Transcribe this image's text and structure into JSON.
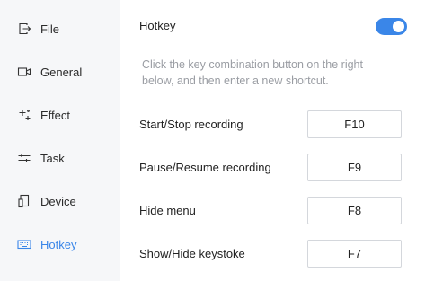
{
  "sidebar": {
    "items": [
      {
        "label": "File",
        "icon": "file-export-icon"
      },
      {
        "label": "General",
        "icon": "video-camera-icon"
      },
      {
        "label": "Effect",
        "icon": "sparkle-icon"
      },
      {
        "label": "Task",
        "icon": "sliders-icon"
      },
      {
        "label": "Device",
        "icon": "device-icon"
      },
      {
        "label": "Hotkey",
        "icon": "keyboard-icon",
        "active": true
      }
    ]
  },
  "hotkey": {
    "title": "Hotkey",
    "enabled": true,
    "description": "Click the key combination button on the right below, and then enter a new shortcut.",
    "rows": [
      {
        "label": "Start/Stop recording",
        "key": "F10"
      },
      {
        "label": "Pause/Resume recording",
        "key": "F9"
      },
      {
        "label": "Hide menu",
        "key": "F8"
      },
      {
        "label": "Show/Hide keystoke",
        "key": "F7"
      }
    ]
  },
  "colors": {
    "accent": "#3a86e8",
    "sidebar_bg": "#f6f7f9",
    "description_text": "#9a9da3"
  }
}
